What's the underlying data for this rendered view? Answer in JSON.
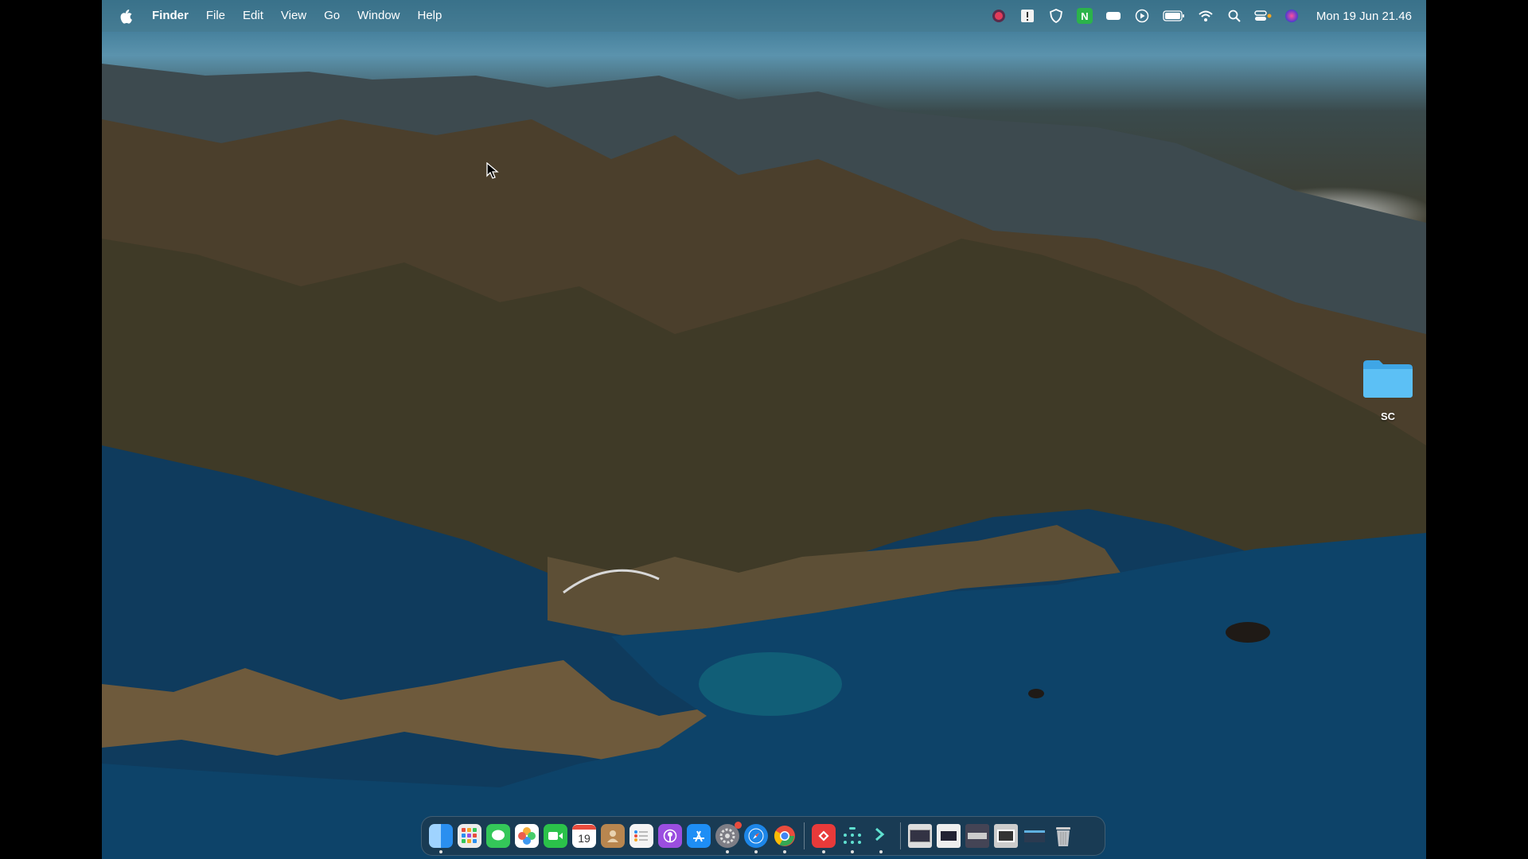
{
  "menubar": {
    "app_name": "Finder",
    "menus": [
      "File",
      "Edit",
      "View",
      "Go",
      "Window",
      "Help"
    ],
    "status_icons": [
      "record-icon",
      "notes-icon",
      "shield-icon",
      "n-app-icon",
      "game-controller-icon",
      "play-circle-icon",
      "battery-icon",
      "wifi-icon",
      "search-icon",
      "control-center-icon",
      "siri-icon"
    ],
    "clock": "Mon 19 Jun  21.46"
  },
  "desktop": {
    "folder_label": "SC"
  },
  "dock": {
    "apps": [
      {
        "name": "Finder",
        "icon": "finder-icon",
        "color": "#2a8ff0",
        "running": true
      },
      {
        "name": "Launchpad",
        "icon": "launchpad-icon",
        "color": "#e8e8e8"
      },
      {
        "name": "Messages",
        "icon": "messages-icon",
        "color": "#34c759"
      },
      {
        "name": "Photos",
        "icon": "photos-icon",
        "color": "#f5a623"
      },
      {
        "name": "FaceTime",
        "icon": "facetime-icon",
        "color": "#2bc24a"
      },
      {
        "name": "Calendar",
        "icon": "calendar-icon",
        "color": "#ffffff",
        "text": "19"
      },
      {
        "name": "Contacts",
        "icon": "contacts-icon",
        "color": "#b8864f"
      },
      {
        "name": "Reminders",
        "icon": "reminders-icon",
        "color": "#f4f4f4"
      },
      {
        "name": "Podcasts",
        "icon": "podcasts-icon",
        "color": "#9b4ee0"
      },
      {
        "name": "App Store",
        "icon": "app-store-icon",
        "color": "#1e8ef5"
      },
      {
        "name": "System Settings",
        "icon": "settings-icon",
        "color": "#7d7d85",
        "running": true
      },
      {
        "name": "Safari",
        "icon": "safari-icon",
        "color": "#1d86e8",
        "running": true
      },
      {
        "name": "Chrome",
        "icon": "chrome-icon",
        "color": "#e8e8e8",
        "running": true
      },
      {
        "name": "AnyDesk",
        "icon": "anydesk-icon",
        "color": "#e83a3a",
        "running": true
      },
      {
        "name": "Dots",
        "icon": "dots-icon",
        "color": "#1a3040",
        "running": true
      },
      {
        "name": "Terminal Dark",
        "icon": "terminal-icon",
        "color": "#1a2a3a",
        "running": true
      }
    ],
    "recents": [
      {
        "name": "Screenshot 1",
        "icon": "screenshot-icon"
      },
      {
        "name": "Screenshot 2",
        "icon": "screenshot-icon"
      },
      {
        "name": "Screenshot 3",
        "icon": "screenshot-icon"
      },
      {
        "name": "Screenshot 4",
        "icon": "screenshot-icon"
      },
      {
        "name": "Screenshot 5",
        "icon": "screenshot-icon"
      }
    ],
    "trash": {
      "name": "Trash",
      "icon": "trash-icon"
    }
  }
}
